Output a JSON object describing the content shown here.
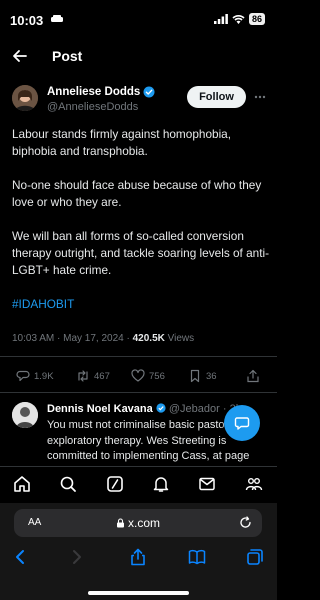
{
  "status_bar": {
    "time": "10:03",
    "battery": "86"
  },
  "header": {
    "title": "Post"
  },
  "post": {
    "author_name": "Anneliese Dodds",
    "author_handle": "@AnnelieseDodds",
    "follow_label": "Follow",
    "paragraphs": [
      "Labour stands firmly against homophobia, biphobia and transphobia.",
      "No-one should face abuse because of who they love or who they are.",
      "We will ban all forms of so-called conversion therapy outright, and tackle soaring levels of anti-LGBT+ hate crime."
    ],
    "hashtag": "#IDAHOBIT",
    "timestamp": "10:03 AM · May 17, 2024 · ",
    "views_count": "420.5K",
    "views_label": " Views",
    "replies": "1.9K",
    "reposts": "467",
    "likes": "756",
    "bookmarks": "36"
  },
  "reply": {
    "name": "Dennis Noel Kavana",
    "handle": "@Jebador · 2h",
    "text": "You must not criminalise basic pastoral or exploratory therapy. Wes Streeting is committed to implementing Cass, at page"
  },
  "browser": {
    "aa_label": "AA",
    "url": "x.com"
  },
  "icons": {
    "back": "back-arrow-icon",
    "verified": "verified-badge-icon",
    "more": "more-icon",
    "fab": "compose-reply-icon",
    "nav": [
      "home-icon",
      "search-icon",
      "grok-icon",
      "notifications-icon",
      "messages-icon",
      "communities-icon"
    ],
    "safari": [
      "back-icon",
      "forward-icon",
      "share-icon",
      "bookmarks-icon",
      "tabs-icon"
    ]
  },
  "colors": {
    "accent": "#1d9bf0",
    "background": "#000000",
    "muted": "#71767b"
  }
}
